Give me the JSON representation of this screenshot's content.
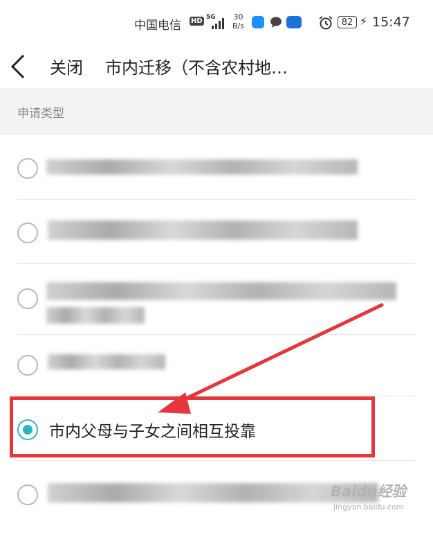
{
  "status_bar": {
    "carrier": "中国电信",
    "hd_badge": "HD",
    "network": "5G",
    "speed_value": "30",
    "speed_unit": "B/s",
    "battery": "82",
    "time": "15:47"
  },
  "nav": {
    "close_label": "关闭",
    "title": "市内迁移（不含农村地…"
  },
  "section": {
    "label": "申请类型"
  },
  "options": {
    "selected_label": "市内父母与子女之间相互投靠"
  },
  "watermark": {
    "brand": "Baidu经验",
    "url": "jingyan.baidu.com"
  },
  "colors": {
    "accent": "#2ab5c6",
    "highlight": "#e8343b"
  }
}
